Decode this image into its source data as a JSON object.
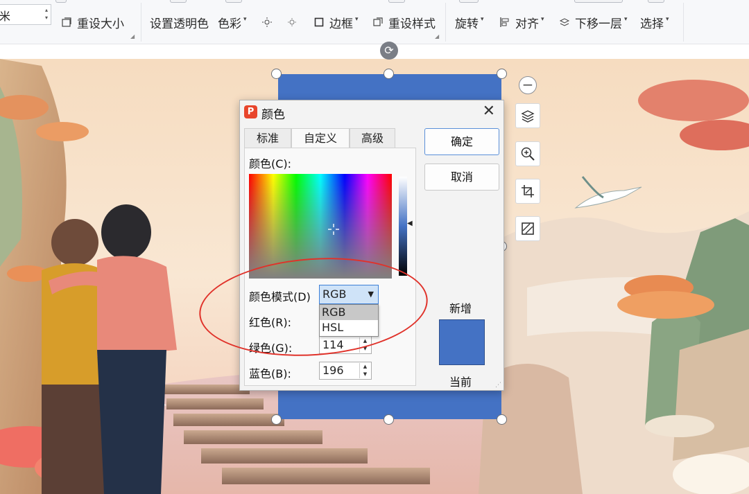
{
  "ribbon": {
    "size_unit": "米",
    "reset_size": "重设大小",
    "set_transparent": "设置透明色",
    "color": "色彩",
    "border": "边框",
    "reset_style": "重设样式",
    "rotate": "旋转",
    "align": "对齐",
    "send_backward": "下移一层",
    "select": "选择"
  },
  "dialog": {
    "title": "颜色",
    "tabs": [
      "标准",
      "自定义",
      "高级"
    ],
    "active_tab": "自定义",
    "color_label": "颜色(C):",
    "color_mode_label": "颜色模式(D)",
    "color_mode_value": "RGB",
    "color_mode_options": [
      "RGB",
      "HSL"
    ],
    "red_label": "红色(R):",
    "green_label": "绿色(G):",
    "green_value": "114",
    "blue_label": "蓝色(B):",
    "blue_value": "196",
    "ok": "确定",
    "cancel": "取消",
    "new_label": "新增",
    "current_label": "当前",
    "current_color": "#4472c4"
  },
  "floating_tools": [
    "zoom-out-icon",
    "layers-icon",
    "zoom-in-icon",
    "crop-icon",
    "fill-icon"
  ],
  "colors": {
    "accent": "#4472c4",
    "annotation": "#e0322a"
  }
}
